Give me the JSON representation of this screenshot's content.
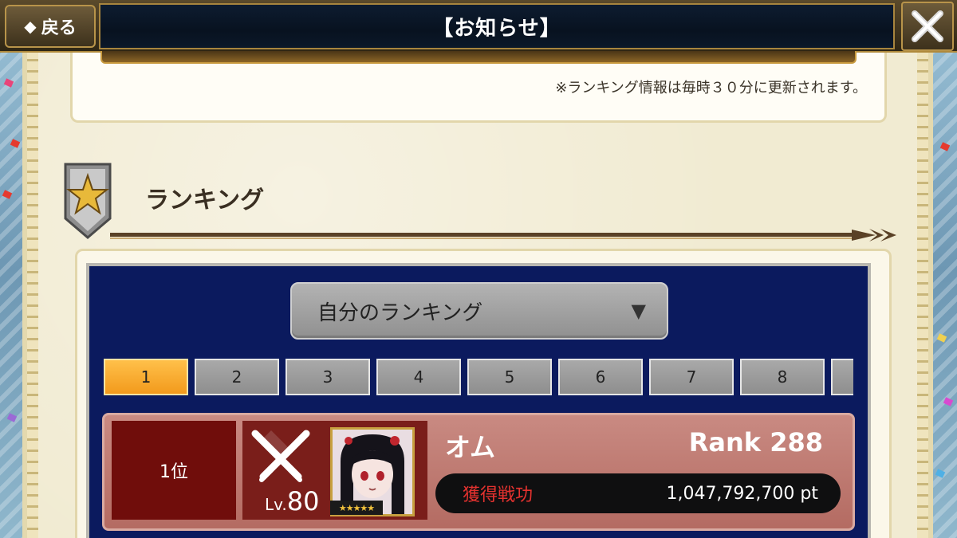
{
  "header": {
    "back_label": "戻る",
    "title": "【お知らせ】",
    "close_icon": "close-icon"
  },
  "notice": {
    "text": "※ランキング情報は毎時３０分に更新されます。"
  },
  "section": {
    "icon": "star-shield-icon",
    "title": "ランキング"
  },
  "ranking": {
    "dropdown": {
      "selected": "自分のランキング",
      "arrow_icon": "triangle-down-icon"
    },
    "pages": [
      "1",
      "2",
      "3",
      "4",
      "5",
      "6",
      "7",
      "8"
    ],
    "active_page": "1",
    "entries": [
      {
        "position": "1位",
        "level_prefix": "Lv.",
        "level": "80",
        "name": "オム",
        "rank": "Rank 288",
        "score_label": "獲得戦功",
        "score": "1,047,792,700 pt",
        "stars": "★★★★★"
      }
    ]
  },
  "colors": {
    "panel_blue": "#0b1a5e",
    "active_page": "#f29a1c",
    "row_red": "#b46b62",
    "position_red": "#700d0b",
    "score_label_red": "#e5322f"
  }
}
